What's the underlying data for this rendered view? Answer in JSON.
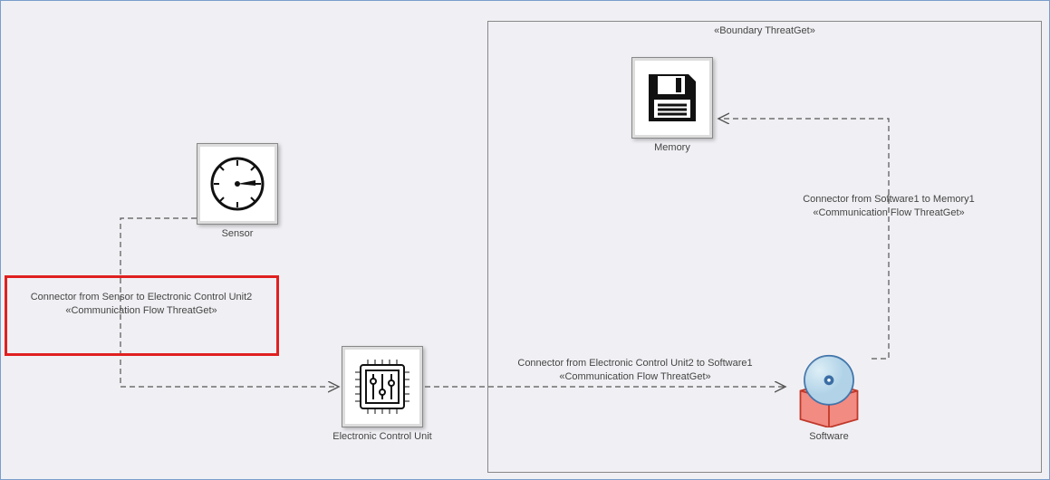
{
  "boundary": {
    "label": "«Boundary ThreatGet»"
  },
  "nodes": {
    "sensor": {
      "label": "Sensor"
    },
    "ecu": {
      "label": "Electronic Control Unit"
    },
    "memory": {
      "label": "Memory"
    },
    "software": {
      "label": "Software"
    }
  },
  "connectors": {
    "sensor_to_ecu": {
      "title": "Connector from Sensor to Electronic Control Unit2",
      "stereotype": "«Communication Flow ThreatGet»"
    },
    "ecu_to_software": {
      "title": "Connector from Electronic Control Unit2 to Software1",
      "stereotype": "«Communication Flow ThreatGet»"
    },
    "software_to_memory": {
      "title": "Connector from Software1 to Memory1",
      "stereotype": "«Communication Flow ThreatGet»"
    }
  }
}
